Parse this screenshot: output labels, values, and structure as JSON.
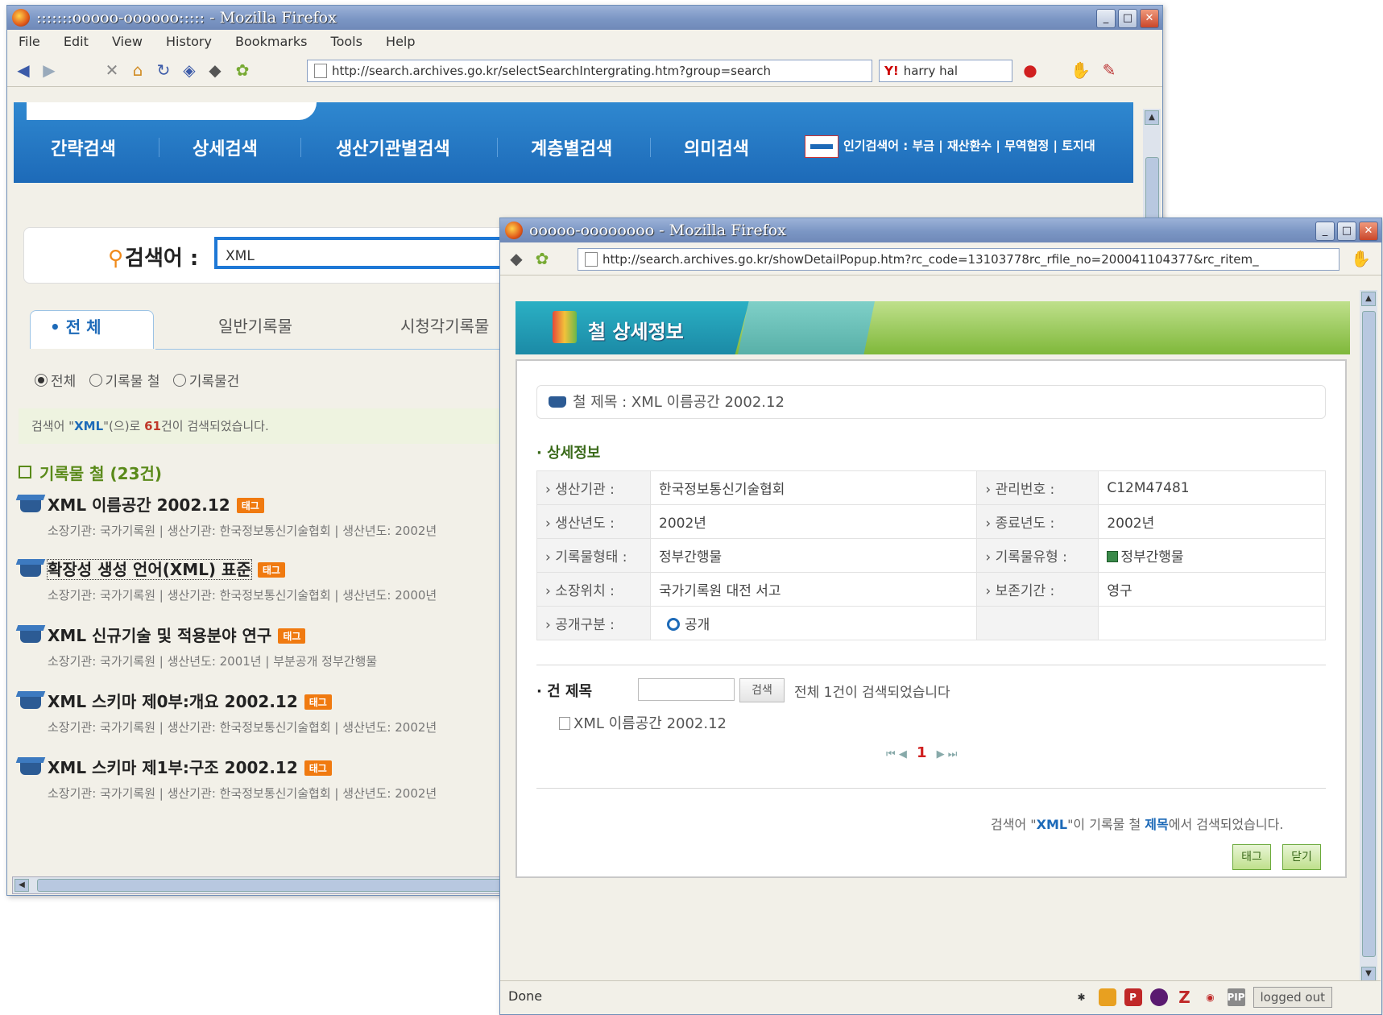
{
  "main_window": {
    "title": ":::::::ooooo-oooooo::::: - Mozilla Firefox",
    "menu": [
      "File",
      "Edit",
      "View",
      "History",
      "Bookmarks",
      "Tools",
      "Help"
    ],
    "url": "http://search.archives.go.kr/selectSearchIntergrating.htm?group=search",
    "search_engine_query": "harry hal",
    "nav": [
      "간략검색",
      "상세검색",
      "생산기관별검색",
      "계층별검색",
      "의미검색"
    ],
    "popular": {
      "label": "인기검색어 :",
      "terms": "부금 | 재산환수 | 무역협정 | 토지대"
    },
    "search": {
      "label": "검색어 :",
      "value": "XML"
    },
    "tabs": [
      "• 전   체",
      "일반기록물",
      "시청각기록물"
    ],
    "filters": [
      "전체",
      "기록물 철",
      "기록물건"
    ],
    "result_summary": {
      "prefix": "검색어 \"",
      "query": "XML",
      "middle": "\"(으)로 ",
      "count": "61",
      "suffix": "건이 검색되었습니다."
    },
    "category": "기록물 철 (23건)",
    "tag_label": "태그",
    "results": [
      {
        "title": "XML 이름공간 2002.12",
        "meta": "소장기관: 국가기록원 | 생산기관: 한국정보통신기술협회 | 생산년도: 2002년"
      },
      {
        "title": "확장성 생성 언어(XML) 표준",
        "meta": "소장기관: 국가기록원 | 생산기관: 한국정보통신기술협회 | 생산년도: 2000년"
      },
      {
        "title": "XML 신규기술 및 적용분야 연구",
        "meta": "소장기관: 국가기록원 | 생산년도: 2001년 |  부분공개  정부간행물"
      },
      {
        "title": "XML 스키마 제0부:개요 2002.12",
        "meta": "소장기관: 국가기록원 | 생산기관: 한국정보통신기술협회 | 생산년도: 2002년"
      },
      {
        "title": "XML 스키마 제1부:구조 2002.12",
        "meta": "소장기관: 국가기록원 | 생산기관: 한국정보통신기술협회 | 생산년도: 2002년"
      }
    ]
  },
  "popup_window": {
    "title": "ooooo-oooooooo - Mozilla Firefox",
    "url": "http://search.archives.go.kr/showDetailPopup.htm?rc_code=13103778rc_rfile_no=200041104377&rc_ritem_",
    "header": "철 상세정보",
    "file_title": "철 제목 : XML 이름공간 2002.12",
    "detail_heading": "상세정보",
    "details": [
      {
        "label1": "생산기관 :",
        "value1": "한국정보통신기술협회",
        "label2": "관리번호 :",
        "value2": "C12M47481"
      },
      {
        "label1": "생산년도 :",
        "value1": "2002년",
        "label2": "종료년도 :",
        "value2": "2002년"
      },
      {
        "label1": "기록물형태 :",
        "value1": "정부간행물",
        "label2": "기록물유형 :",
        "value2": "정부간행물"
      },
      {
        "label1": "소장위치 :",
        "value1": "국가기록원 대전 서고",
        "label2": "보존기간 :",
        "value2": "영구"
      },
      {
        "label1": "공개구분 :",
        "value1": "공개",
        "label2": "",
        "value2": ""
      }
    ],
    "item_heading": "건 제목",
    "item_search_button": "검색",
    "item_result": "전체 1건이 검색되었습니다",
    "item_list": [
      "XML 이름공간 2002.12"
    ],
    "current_page": "1",
    "footer": {
      "prefix": "검색어 \"",
      "query": "XML",
      "middle": "\"이 기록물 철 ",
      "field": "제목",
      "suffix": "에서 검색되었습니다."
    },
    "buttons": {
      "tag": "태그",
      "close": "닫기"
    },
    "status": "Done",
    "logged": "logged out"
  }
}
